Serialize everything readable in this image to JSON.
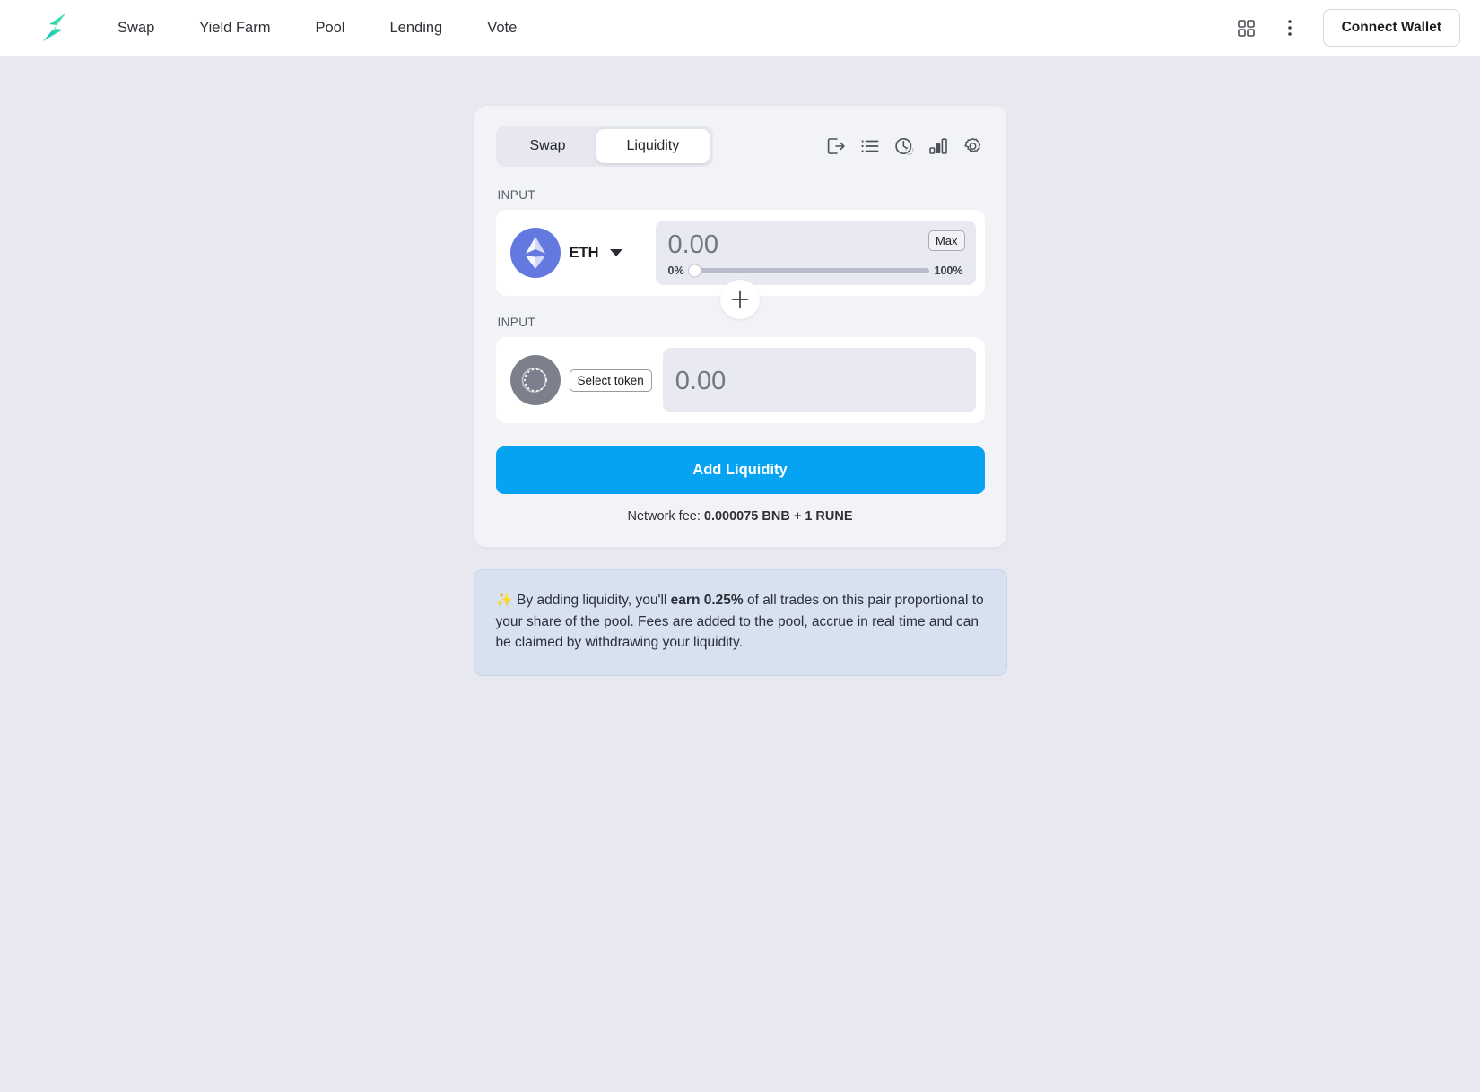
{
  "nav": {
    "logo_icon": "lightning-bolt-logo",
    "links": [
      {
        "label": "Swap"
      },
      {
        "label": "Yield Farm"
      },
      {
        "label": "Pool"
      },
      {
        "label": "Lending"
      },
      {
        "label": "Vote"
      }
    ],
    "grid_icon": "grid-apps-icon",
    "more_icon": "more-vertical-icon",
    "connect_label": "Connect Wallet"
  },
  "card": {
    "tabs": [
      {
        "label": "Swap",
        "active": false
      },
      {
        "label": "Liquidity",
        "active": true
      }
    ],
    "icons": [
      {
        "name": "export-icon"
      },
      {
        "name": "list-icon"
      },
      {
        "name": "history-clock-icon"
      },
      {
        "name": "chart-bars-icon"
      },
      {
        "name": "settings-gear-icon"
      }
    ],
    "input_one": {
      "label": "INPUT",
      "token_symbol": "ETH",
      "token_icon": "ethereum-icon",
      "amount": "0.00",
      "max_label": "Max",
      "slider_min_label": "0%",
      "slider_max_label": "100%",
      "slider_value": 0
    },
    "plus_icon": "plus-icon",
    "input_two": {
      "label": "INPUT",
      "select_token_label": "Select token",
      "token_icon": "placeholder-coin-icon",
      "amount": "0.00"
    },
    "submit_label": "Add Liquidity",
    "fee_prefix": "Network fee: ",
    "fee_value": "0.000075 BNB + 1 RUNE"
  },
  "banner": {
    "sparkle": "✨",
    "text_part1": " By adding liquidity, you'll ",
    "highlight": "earn 0.25%",
    "text_part2": " of all trades on this pair proportional to your share of the pool. Fees are added to the pool, accrue in real time and can be claimed by withdrawing your liquidity."
  },
  "colors": {
    "accent": "#06a3f2",
    "logo": "#2fd6a8",
    "eth": "#6379e0",
    "banner_bg": "#d7e1ef"
  }
}
